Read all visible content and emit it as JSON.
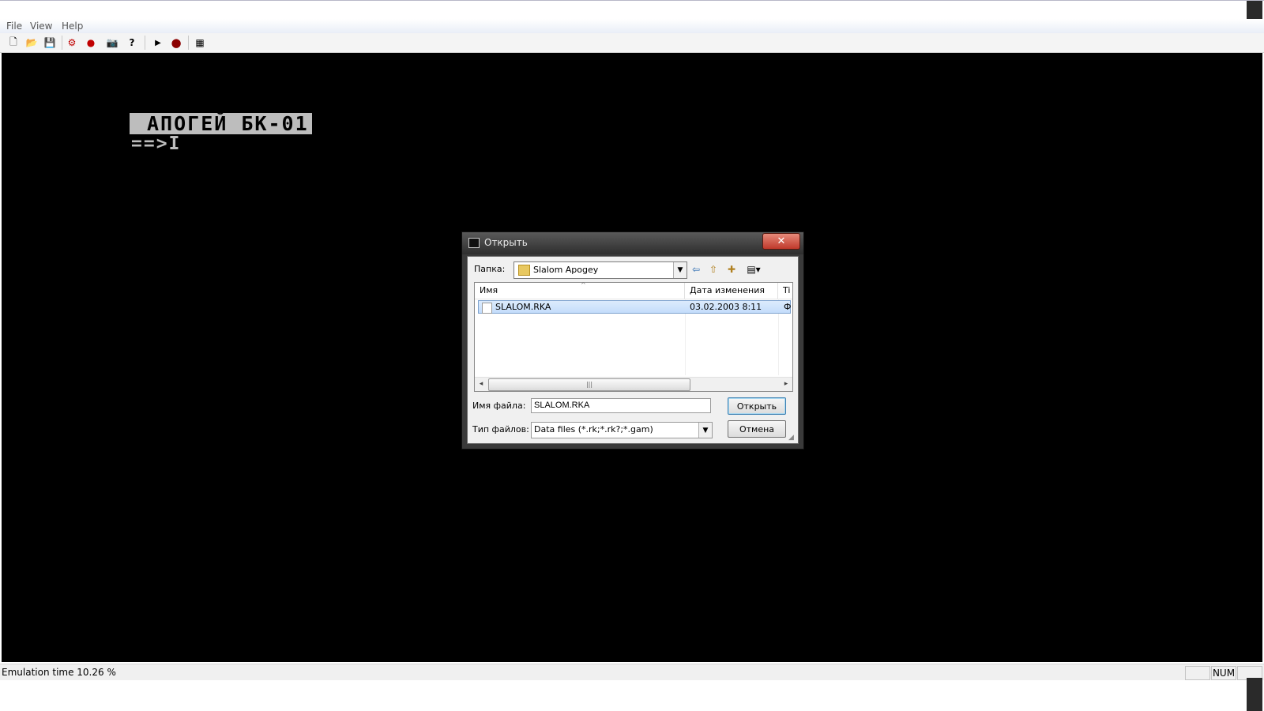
{
  "menu": {
    "items": [
      "File",
      "View",
      "Help"
    ]
  },
  "toolbar": {
    "buttons": [
      {
        "icon": "new-file-icon",
        "glyph": "🗋",
        "color": "#000000"
      },
      {
        "icon": "open-folder-icon",
        "glyph": "📂",
        "color": "#b08020"
      },
      {
        "icon": "save-icon",
        "glyph": "💾",
        "color": "#000000"
      },
      {
        "icon": "settings-icon",
        "glyph": "⚙",
        "color": "#c00000"
      },
      {
        "icon": "record-icon",
        "glyph": "●",
        "color": "#c00000"
      },
      {
        "icon": "screenshot-icon",
        "glyph": "📷",
        "color": "#000000"
      },
      {
        "icon": "help-icon",
        "glyph": "?",
        "color": "#000000"
      },
      {
        "icon": "play-icon",
        "glyph": "▶",
        "color": "#000000"
      },
      {
        "icon": "stop-icon",
        "glyph": "●",
        "color": "#8b0000"
      },
      {
        "icon": "keyboard-icon",
        "glyph": "▦",
        "color": "#000000"
      }
    ]
  },
  "screen": {
    "banner": "АПОГЕЙ БК-01",
    "prompt": "==>I"
  },
  "status": {
    "emulation": "Emulation time 10.26 %",
    "num": "NUM"
  },
  "dialog": {
    "title": "Открыть",
    "close": "✕",
    "folder_label": "Папка:",
    "folder_value": "Slalom Apogey",
    "columns": {
      "name": "Имя",
      "date": "Дата изменения",
      "type": "Ti"
    },
    "files": [
      {
        "name": "SLALOM.RKA",
        "date": "03.02.2003 8:11",
        "type": "Ф"
      }
    ],
    "filename_label": "Имя файла:",
    "filename_value": "SLALOM.RKA",
    "filetype_label": "Тип файлов:",
    "filetype_value": "Data files (*.rk;*.rk?;*.gam)",
    "open_button": "Открыть",
    "cancel_button": "Отмена"
  },
  "colors": {
    "screen_bg": "#000000",
    "banner_bg": "#bdbdbd",
    "selection": "#c4ddfb"
  }
}
